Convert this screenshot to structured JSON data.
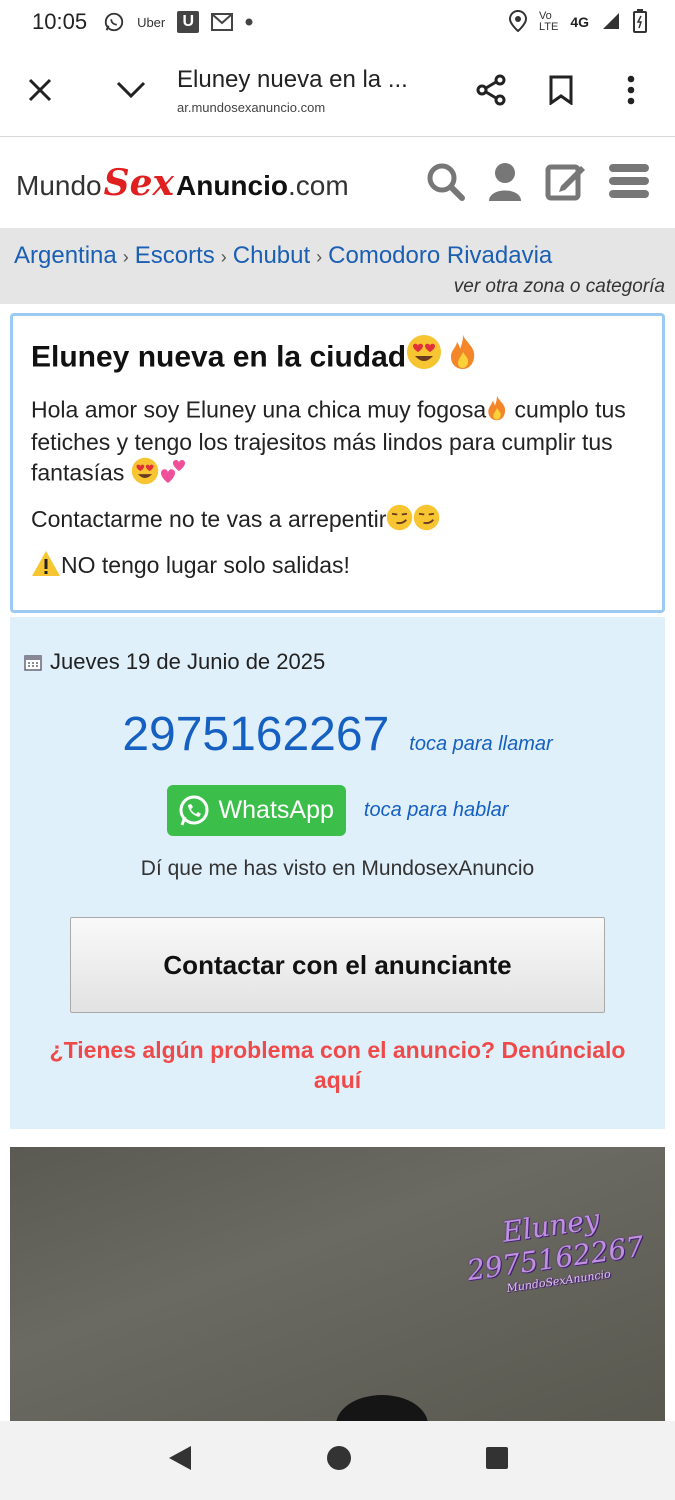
{
  "status_bar": {
    "time": "10:05",
    "notif_uber": "Uber",
    "notif_u": "U",
    "network": "4G",
    "lte": "LTE",
    "volte": "Vo"
  },
  "browser": {
    "title": "Eluney nueva en la ...",
    "url": "ar.mundosexanuncio.com",
    "icons": [
      "close-icon",
      "chevron-down-icon",
      "share-icon",
      "bookmark-icon",
      "more-icon"
    ]
  },
  "site": {
    "logo_mundo": "Mundo",
    "logo_sex": "Sex",
    "logo_anuncio": "Anuncio",
    "logo_com": ".com",
    "icons": [
      "search-icon",
      "user-icon",
      "edit-icon",
      "menu-icon"
    ]
  },
  "breadcrumb": {
    "items": [
      "Argentina",
      "Escorts",
      "Chubut",
      "Comodoro Rivadavia"
    ],
    "separator": "›",
    "other_zone": "ver otra zona o categoría"
  },
  "ad": {
    "title": "Eluney nueva en la ciudad",
    "paragraph1": "Hola amor soy Eluney una chica muy fogosa",
    "paragraph1b": "cumplo tus fetiches y tengo los trajesitos más lindos para cumplir tus fantasías",
    "paragraph2": "Contactarme no te vas a arrepentir",
    "paragraph3": "NO tengo lugar solo salidas!"
  },
  "contact": {
    "date": "Jueves 19 de Junio de 2025",
    "phone": "2975162267",
    "call_hint": "toca para llamar",
    "whatsapp_label": "WhatsApp",
    "chat_hint": "toca para hablar",
    "tell_them": "Dí que me has visto en MundosexAnuncio",
    "contact_button": "Contactar con el anunciante",
    "report_text": "¿Tienes algún problema con el anuncio? Denúncialo aquí"
  },
  "photo": {
    "watermark_name": "Eluney",
    "watermark_phone": "2975162267",
    "watermark_site": "MundoSexAnuncio"
  },
  "colors": {
    "link_blue": "#1a5fb4",
    "phone_blue": "#1560c0",
    "whatsapp_green": "#3cbf4a",
    "report_red": "#ee4a4a",
    "contact_bg": "#e0f0fb",
    "card_border": "#9ccaf2"
  }
}
